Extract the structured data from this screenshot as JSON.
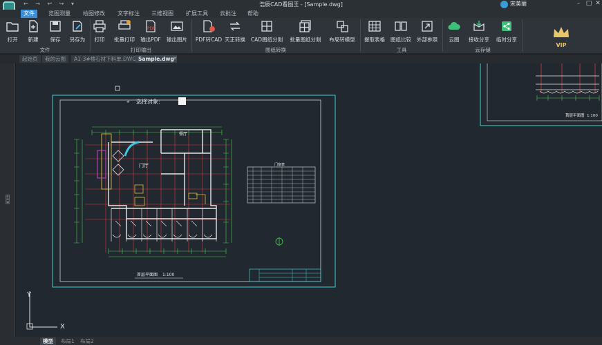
{
  "window": {
    "title": "浩辰CAD看图王 - [Sample.dwg]",
    "brand": "宋美丽",
    "quick_access": "← → ↩ ↪ ▾"
  },
  "menu": {
    "items": [
      "文件",
      "览图测量",
      "绘图修改",
      "文字标注",
      "三维视图",
      "扩展工具",
      "云批注",
      "帮助"
    ],
    "active": "文件"
  },
  "ribbon": {
    "groups": [
      {
        "label": "文件",
        "tools": [
          "打开",
          "新建",
          "保存",
          "另存为"
        ]
      },
      {
        "label": "打印输出",
        "tools": [
          "打印",
          "批量打印",
          "输出PDF",
          "输出图片"
        ]
      },
      {
        "label": "图纸转换",
        "tools": [
          "PDF转CAD",
          "天正转换",
          "CAD图纸分割",
          "批量图纸分割",
          "布局转模型"
        ]
      },
      {
        "label": "工具",
        "tools": [
          "提取表格",
          "图纸比较",
          "外部参照"
        ]
      },
      {
        "label": "云存储",
        "tools": [
          "云图",
          "接收分享",
          "临时分享"
        ]
      }
    ],
    "vip": "VIP"
  },
  "doc_tabs": [
    "起始页",
    "我的云图",
    "A1-3#楼石材下料单.DWG",
    "Sample.dwg"
  ],
  "active_doc_tab": "Sample.dwg",
  "left_panel_label": "图层",
  "canvas": {
    "select_prompt": "选择对象:",
    "drawing_title": "首层平面图",
    "drawing_scale": "1:100",
    "drawing_title_2": "首层平面图",
    "drawing_scale_2": "1:100",
    "room_labels": [
      "门厅",
      "餐厅"
    ],
    "table_title": "门窗表",
    "axis_y": "Y",
    "axis_x": "X"
  },
  "layout_tabs": [
    "模型",
    "布局1",
    "布局2"
  ],
  "active_layout_tab": "模型",
  "colors": {
    "accent": "#3a8fd8",
    "canvas_bg": "#212830",
    "frame": "#3fcfcf",
    "wall": "#e8e8e8",
    "grid_red": "#d83a3a",
    "dim_green": "#4ad04a",
    "yellow": "#e0c040",
    "magenta": "#d040d0",
    "cyan": "#40c8e0"
  }
}
